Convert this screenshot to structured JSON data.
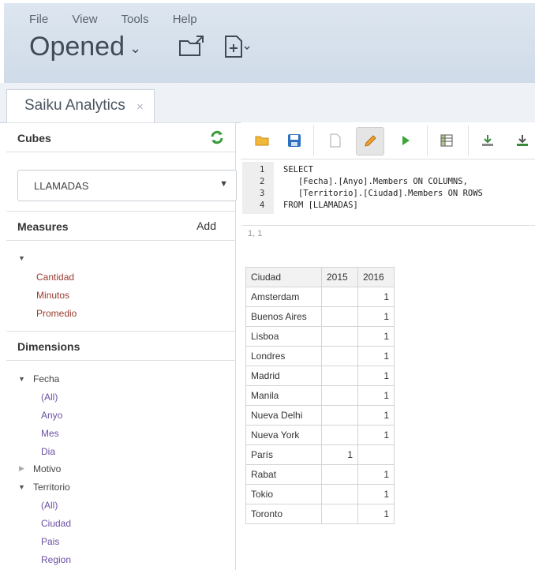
{
  "menu": {
    "file": "File",
    "view": "View",
    "tools": "Tools",
    "help": "Help"
  },
  "header": {
    "opened": "Opened"
  },
  "tab": {
    "title": "Saiku Analytics",
    "close": "×"
  },
  "cubes": {
    "title": "Cubes",
    "selected": "LLAMADAS"
  },
  "measures": {
    "title": "Measures",
    "add": "Add",
    "items": [
      "Cantidad",
      "Minutos",
      "Promedio"
    ]
  },
  "dimensions": {
    "title": "Dimensions",
    "fecha": {
      "label": "Fecha",
      "levels": [
        "(All)",
        "Anyo",
        "Mes",
        "Dia"
      ]
    },
    "motivo": {
      "label": "Motivo"
    },
    "territorio": {
      "label": "Territorio",
      "levels": [
        "(All)",
        "Ciudad",
        "Pais",
        "Region"
      ]
    }
  },
  "editor": {
    "line_numbers": [
      "1",
      "2",
      "3",
      "4"
    ],
    "lines": [
      "SELECT",
      "   [Fecha].[Anyo].Members ON COLUMNS,",
      "   [Territorio].[Ciudad].Members ON ROWS",
      "FROM [LLAMADAS]"
    ],
    "cursor": "1, 1"
  },
  "results": {
    "headers": [
      "Ciudad",
      "2015",
      "2016"
    ],
    "rows": [
      [
        "Amsterdam",
        "",
        "1"
      ],
      [
        "Buenos Aires",
        "",
        "1"
      ],
      [
        "Lisboa",
        "",
        "1"
      ],
      [
        "Londres",
        "",
        "1"
      ],
      [
        "Madrid",
        "",
        "1"
      ],
      [
        "Manila",
        "",
        "1"
      ],
      [
        "Nueva Delhi",
        "",
        "1"
      ],
      [
        "Nueva York",
        "",
        "1"
      ],
      [
        "París",
        "1",
        ""
      ],
      [
        "Rabat",
        "",
        "1"
      ],
      [
        "Tokio",
        "",
        "1"
      ],
      [
        "Toronto",
        "",
        "1"
      ]
    ]
  },
  "colors": {
    "measure": "#9a3b2f",
    "refresh": "#3a9a3a",
    "accent": "#f0a030"
  }
}
